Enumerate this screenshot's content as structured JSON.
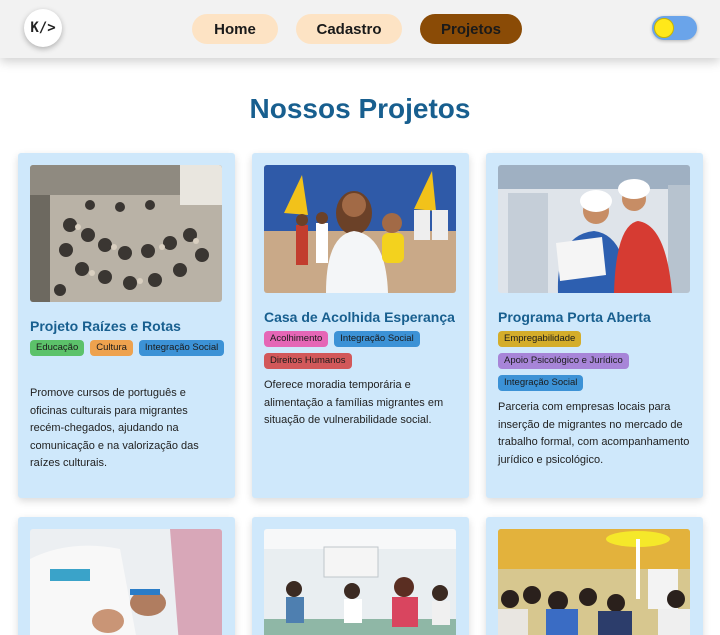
{
  "nav": {
    "logo": "K/>",
    "items": [
      {
        "label": "Home",
        "active": false
      },
      {
        "label": "Cadastro",
        "active": false
      },
      {
        "label": "Projetos",
        "active": true
      }
    ],
    "theme_toggle": "light-mode-toggle"
  },
  "page_title": "Nossos Projetos",
  "projects": [
    {
      "title": "Projeto Raízes e Rotas",
      "tags": [
        "Educação",
        "Cultura",
        "Integração Social"
      ],
      "description": "Promove cursos de português e oficinas culturais para migrantes recém-chegados, ajudando na comunicação e na valorização das raízes culturais."
    },
    {
      "title": "Casa de Acolhida Esperança",
      "tags": [
        "Acolhimento",
        "Integração Social",
        "Direitos Humanos"
      ],
      "description": "Oferece moradia temporária e alimentação a famílias migrantes em situação de vulnerabilidade social."
    },
    {
      "title": "Programa Porta Aberta",
      "tags": [
        "Empregabilidade",
        "Apoio Psicológico e Jurídico",
        "Integração Social"
      ],
      "description": "Parceria com empresas locais para inserção de migrantes no mercado de trabalho formal, com acompanhamento jurídico e psicológico."
    }
  ],
  "colors": {
    "title": "#185f8f",
    "card_bg": "#cfe8fb",
    "nav_bg": "#f2f2f2",
    "nav_pill": "#fde3c4",
    "nav_active": "#8a4b06"
  }
}
